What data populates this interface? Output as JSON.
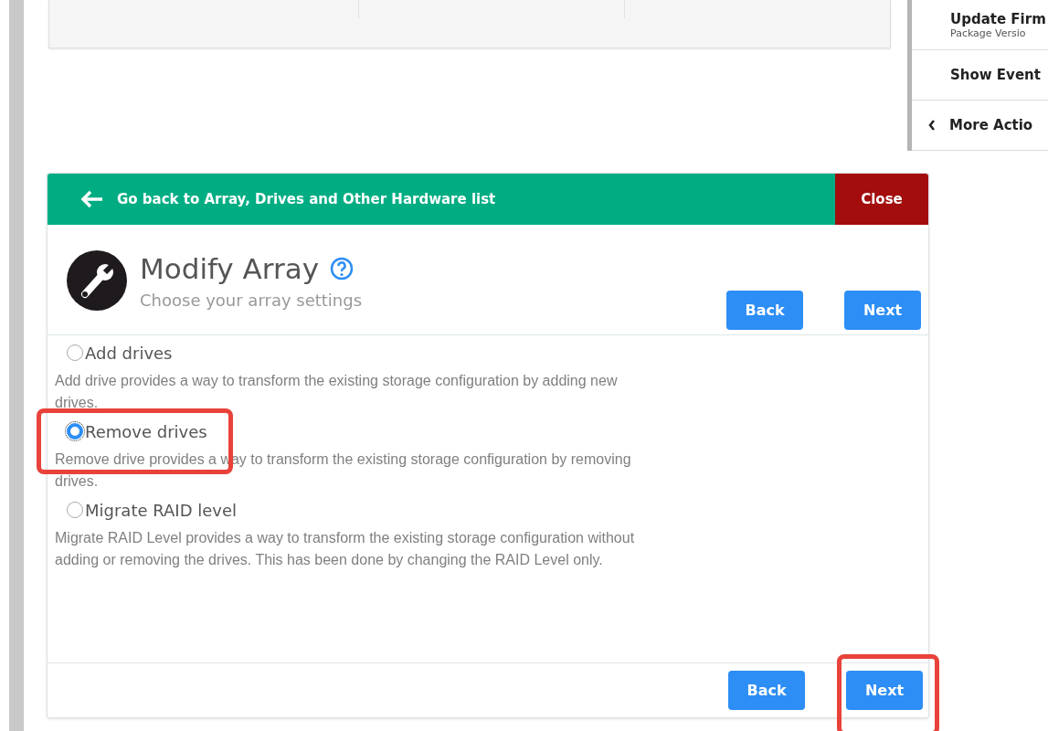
{
  "side_panel": {
    "items": [
      {
        "label": "Update Firm",
        "sublabel": "Package Versio",
        "kind": "plain"
      },
      {
        "label": "Show Event",
        "kind": "plain"
      },
      {
        "label": "More Actio",
        "kind": "collapse"
      }
    ]
  },
  "dialog": {
    "back_link": "Go back to Array, Drives and Other Hardware list",
    "close": "Close",
    "title": "Modify Array",
    "subtitle": "Choose your array settings",
    "top_buttons": [
      {
        "label": "Back",
        "highlighted": false
      },
      {
        "label": "Next",
        "highlighted": false
      }
    ],
    "options": [
      {
        "label": "Add drives",
        "description": "Add drive provides a way to transform the existing storage configuration by adding new drives.",
        "selected": false,
        "highlighted": false
      },
      {
        "label": "Remove drives",
        "description": "Remove drive provides a way to transform the existing storage configuration by removing drives.",
        "selected": true,
        "highlighted": true
      },
      {
        "label": "Migrate RAID level",
        "description": "Migrate RAID Level provides a way to transform the existing storage configuration without adding or removing the drives. This has been done by changing the RAID Level only.",
        "selected": false,
        "highlighted": false
      }
    ],
    "bottom_buttons": [
      {
        "label": "Back",
        "highlighted": false
      },
      {
        "label": "Next",
        "highlighted": true
      }
    ]
  }
}
